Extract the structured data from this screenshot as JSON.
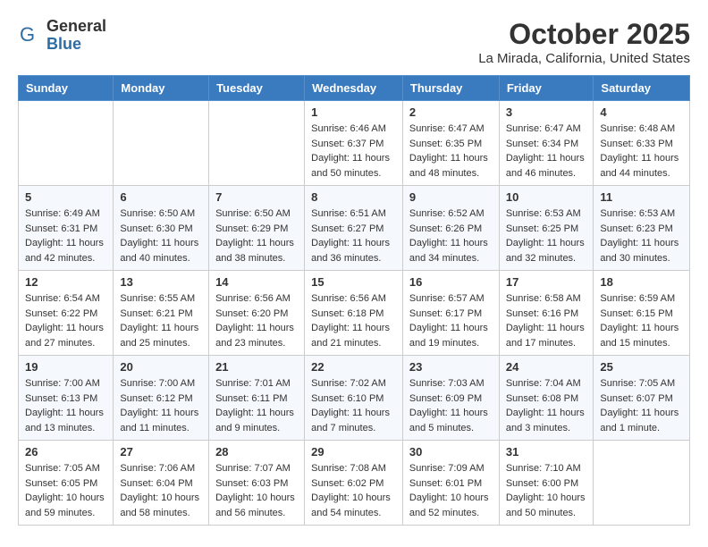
{
  "header": {
    "logo": {
      "general": "General",
      "blue": "Blue"
    },
    "title": "October 2025",
    "location": "La Mirada, California, United States"
  },
  "weekdays": [
    "Sunday",
    "Monday",
    "Tuesday",
    "Wednesday",
    "Thursday",
    "Friday",
    "Saturday"
  ],
  "weeks": [
    [
      {
        "day": "",
        "info": ""
      },
      {
        "day": "",
        "info": ""
      },
      {
        "day": "",
        "info": ""
      },
      {
        "day": "1",
        "info": "Sunrise: 6:46 AM\nSunset: 6:37 PM\nDaylight: 11 hours\nand 50 minutes."
      },
      {
        "day": "2",
        "info": "Sunrise: 6:47 AM\nSunset: 6:35 PM\nDaylight: 11 hours\nand 48 minutes."
      },
      {
        "day": "3",
        "info": "Sunrise: 6:47 AM\nSunset: 6:34 PM\nDaylight: 11 hours\nand 46 minutes."
      },
      {
        "day": "4",
        "info": "Sunrise: 6:48 AM\nSunset: 6:33 PM\nDaylight: 11 hours\nand 44 minutes."
      }
    ],
    [
      {
        "day": "5",
        "info": "Sunrise: 6:49 AM\nSunset: 6:31 PM\nDaylight: 11 hours\nand 42 minutes."
      },
      {
        "day": "6",
        "info": "Sunrise: 6:50 AM\nSunset: 6:30 PM\nDaylight: 11 hours\nand 40 minutes."
      },
      {
        "day": "7",
        "info": "Sunrise: 6:50 AM\nSunset: 6:29 PM\nDaylight: 11 hours\nand 38 minutes."
      },
      {
        "day": "8",
        "info": "Sunrise: 6:51 AM\nSunset: 6:27 PM\nDaylight: 11 hours\nand 36 minutes."
      },
      {
        "day": "9",
        "info": "Sunrise: 6:52 AM\nSunset: 6:26 PM\nDaylight: 11 hours\nand 34 minutes."
      },
      {
        "day": "10",
        "info": "Sunrise: 6:53 AM\nSunset: 6:25 PM\nDaylight: 11 hours\nand 32 minutes."
      },
      {
        "day": "11",
        "info": "Sunrise: 6:53 AM\nSunset: 6:23 PM\nDaylight: 11 hours\nand 30 minutes."
      }
    ],
    [
      {
        "day": "12",
        "info": "Sunrise: 6:54 AM\nSunset: 6:22 PM\nDaylight: 11 hours\nand 27 minutes."
      },
      {
        "day": "13",
        "info": "Sunrise: 6:55 AM\nSunset: 6:21 PM\nDaylight: 11 hours\nand 25 minutes."
      },
      {
        "day": "14",
        "info": "Sunrise: 6:56 AM\nSunset: 6:20 PM\nDaylight: 11 hours\nand 23 minutes."
      },
      {
        "day": "15",
        "info": "Sunrise: 6:56 AM\nSunset: 6:18 PM\nDaylight: 11 hours\nand 21 minutes."
      },
      {
        "day": "16",
        "info": "Sunrise: 6:57 AM\nSunset: 6:17 PM\nDaylight: 11 hours\nand 19 minutes."
      },
      {
        "day": "17",
        "info": "Sunrise: 6:58 AM\nSunset: 6:16 PM\nDaylight: 11 hours\nand 17 minutes."
      },
      {
        "day": "18",
        "info": "Sunrise: 6:59 AM\nSunset: 6:15 PM\nDaylight: 11 hours\nand 15 minutes."
      }
    ],
    [
      {
        "day": "19",
        "info": "Sunrise: 7:00 AM\nSunset: 6:13 PM\nDaylight: 11 hours\nand 13 minutes."
      },
      {
        "day": "20",
        "info": "Sunrise: 7:00 AM\nSunset: 6:12 PM\nDaylight: 11 hours\nand 11 minutes."
      },
      {
        "day": "21",
        "info": "Sunrise: 7:01 AM\nSunset: 6:11 PM\nDaylight: 11 hours\nand 9 minutes."
      },
      {
        "day": "22",
        "info": "Sunrise: 7:02 AM\nSunset: 6:10 PM\nDaylight: 11 hours\nand 7 minutes."
      },
      {
        "day": "23",
        "info": "Sunrise: 7:03 AM\nSunset: 6:09 PM\nDaylight: 11 hours\nand 5 minutes."
      },
      {
        "day": "24",
        "info": "Sunrise: 7:04 AM\nSunset: 6:08 PM\nDaylight: 11 hours\nand 3 minutes."
      },
      {
        "day": "25",
        "info": "Sunrise: 7:05 AM\nSunset: 6:07 PM\nDaylight: 11 hours\nand 1 minute."
      }
    ],
    [
      {
        "day": "26",
        "info": "Sunrise: 7:05 AM\nSunset: 6:05 PM\nDaylight: 10 hours\nand 59 minutes."
      },
      {
        "day": "27",
        "info": "Sunrise: 7:06 AM\nSunset: 6:04 PM\nDaylight: 10 hours\nand 58 minutes."
      },
      {
        "day": "28",
        "info": "Sunrise: 7:07 AM\nSunset: 6:03 PM\nDaylight: 10 hours\nand 56 minutes."
      },
      {
        "day": "29",
        "info": "Sunrise: 7:08 AM\nSunset: 6:02 PM\nDaylight: 10 hours\nand 54 minutes."
      },
      {
        "day": "30",
        "info": "Sunrise: 7:09 AM\nSunset: 6:01 PM\nDaylight: 10 hours\nand 52 minutes."
      },
      {
        "day": "31",
        "info": "Sunrise: 7:10 AM\nSunset: 6:00 PM\nDaylight: 10 hours\nand 50 minutes."
      },
      {
        "day": "",
        "info": ""
      }
    ]
  ]
}
